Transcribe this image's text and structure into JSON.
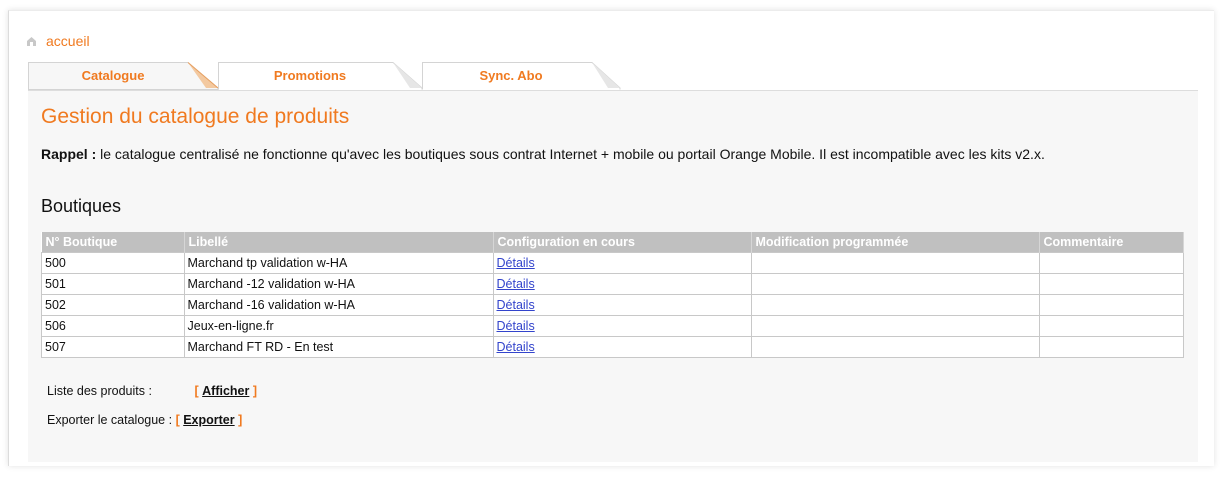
{
  "breadcrumb": {
    "home_label": "accueil"
  },
  "tabs": [
    {
      "label": "Catalogue"
    },
    {
      "label": "Promotions"
    },
    {
      "label": "Sync. Abo"
    }
  ],
  "page": {
    "title": "Gestion du catalogue de produits",
    "reminder_label": "Rappel :",
    "reminder_text": " le catalogue centralisé ne fonctionne qu'avec les boutiques sous contrat Internet + mobile ou portail Orange Mobile. Il est incompatible avec les kits v2.x.",
    "section_title": "Boutiques"
  },
  "table": {
    "headers": [
      "N° Boutique",
      "Libellé",
      "Configuration en cours",
      "Modification programmée",
      "Commentaire"
    ],
    "rows": [
      {
        "id": "500",
        "label": "Marchand tp validation w-HA",
        "config": "Détails",
        "modif": "",
        "comment": ""
      },
      {
        "id": "501",
        "label": "Marchand -12 validation w-HA",
        "config": "Détails",
        "modif": "",
        "comment": ""
      },
      {
        "id": "502",
        "label": "Marchand -16 validation w-HA",
        "config": "Détails",
        "modif": "",
        "comment": ""
      },
      {
        "id": "506",
        "label": "Jeux-en-ligne.fr",
        "config": "Détails",
        "modif": "",
        "comment": ""
      },
      {
        "id": "507",
        "label": "Marchand FT RD - En test",
        "config": "Détails",
        "modif": "",
        "comment": ""
      }
    ]
  },
  "actions": {
    "products_label": "Liste des produits :",
    "products_link": "Afficher",
    "export_label": "Exporter le catalogue :",
    "export_link": "Exporter",
    "bracket_open": "[",
    "bracket_close": "]"
  },
  "colors": {
    "accent": "#f07a20",
    "header_bg": "#c0c0c0",
    "link": "#3344cc"
  }
}
